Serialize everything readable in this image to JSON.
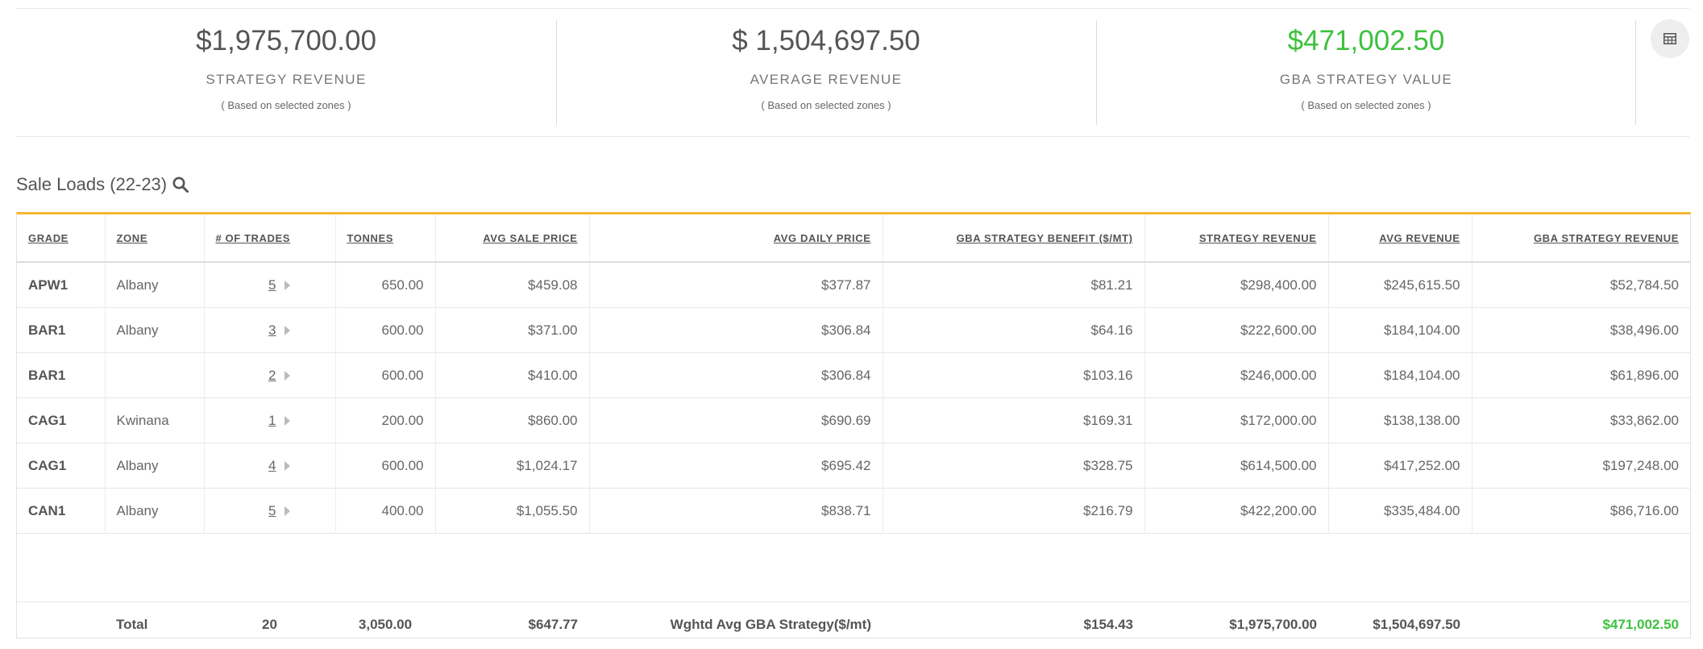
{
  "summary": {
    "strategy_revenue": {
      "value": "$1,975,700.00",
      "label": "STRATEGY REVENUE",
      "sub": "( Based on selected zones )"
    },
    "average_revenue": {
      "value": "$ 1,504,697.50",
      "label": "AVERAGE REVENUE",
      "sub": "( Based on selected zones )"
    },
    "gba_strategy_value": {
      "value": "$471,002.50",
      "label": "GBA STRATEGY VALUE",
      "sub": "( Based on selected zones )"
    },
    "value_color": "#3ec13e",
    "grid_toggle_icon": "table-grid-icon"
  },
  "section": {
    "title": "Sale Loads (22-23)",
    "icon": "search-icon"
  },
  "accent_color": "#f5b833",
  "table": {
    "headers": [
      "GRADE",
      "ZONE",
      "# OF TRADES",
      "TONNES",
      "AVG SALE PRICE",
      "AVG DAILY PRICE",
      "GBA STRATEGY BENEFIT ($/MT)",
      "STRATEGY REVENUE",
      "AVG REVENUE",
      "GBA STRATEGY REVENUE"
    ],
    "rows": [
      [
        "APW1",
        "Albany",
        "5",
        "650.00",
        "$459.08",
        "$377.87",
        "$81.21",
        "$298,400.00",
        "$245,615.50",
        "$52,784.50"
      ],
      [
        "BAR1",
        "Albany",
        "3",
        "600.00",
        "$371.00",
        "$306.84",
        "$64.16",
        "$222,600.00",
        "$184,104.00",
        "$38,496.00"
      ],
      [
        "BAR1",
        "",
        "2",
        "600.00",
        "$410.00",
        "$306.84",
        "$103.16",
        "$246,000.00",
        "$184,104.00",
        "$61,896.00"
      ],
      [
        "CAG1",
        "Kwinana",
        "1",
        "200.00",
        "$860.00",
        "$690.69",
        "$169.31",
        "$172,000.00",
        "$138,138.00",
        "$33,862.00"
      ],
      [
        "CAG1",
        "Albany",
        "4",
        "600.00",
        "$1,024.17",
        "$695.42",
        "$328.75",
        "$614,500.00",
        "$417,252.00",
        "$197,248.00"
      ],
      [
        "CAN1",
        "Albany",
        "5",
        "400.00",
        "$1,055.50",
        "$838.71",
        "$216.79",
        "$422,200.00",
        "$335,484.00",
        "$86,716.00"
      ]
    ],
    "total": {
      "label": "Total",
      "trades": "20",
      "tonnes": "3,050.00",
      "avg_sale_price": "$647.77",
      "wghtd_label": "Wghtd Avg GBA Strategy($/mt)",
      "gba_benefit": "$154.43",
      "strategy_revenue": "$1,975,700.00",
      "avg_revenue": "$1,504,697.50",
      "gba_strategy_revenue": "$471,002.50"
    }
  }
}
